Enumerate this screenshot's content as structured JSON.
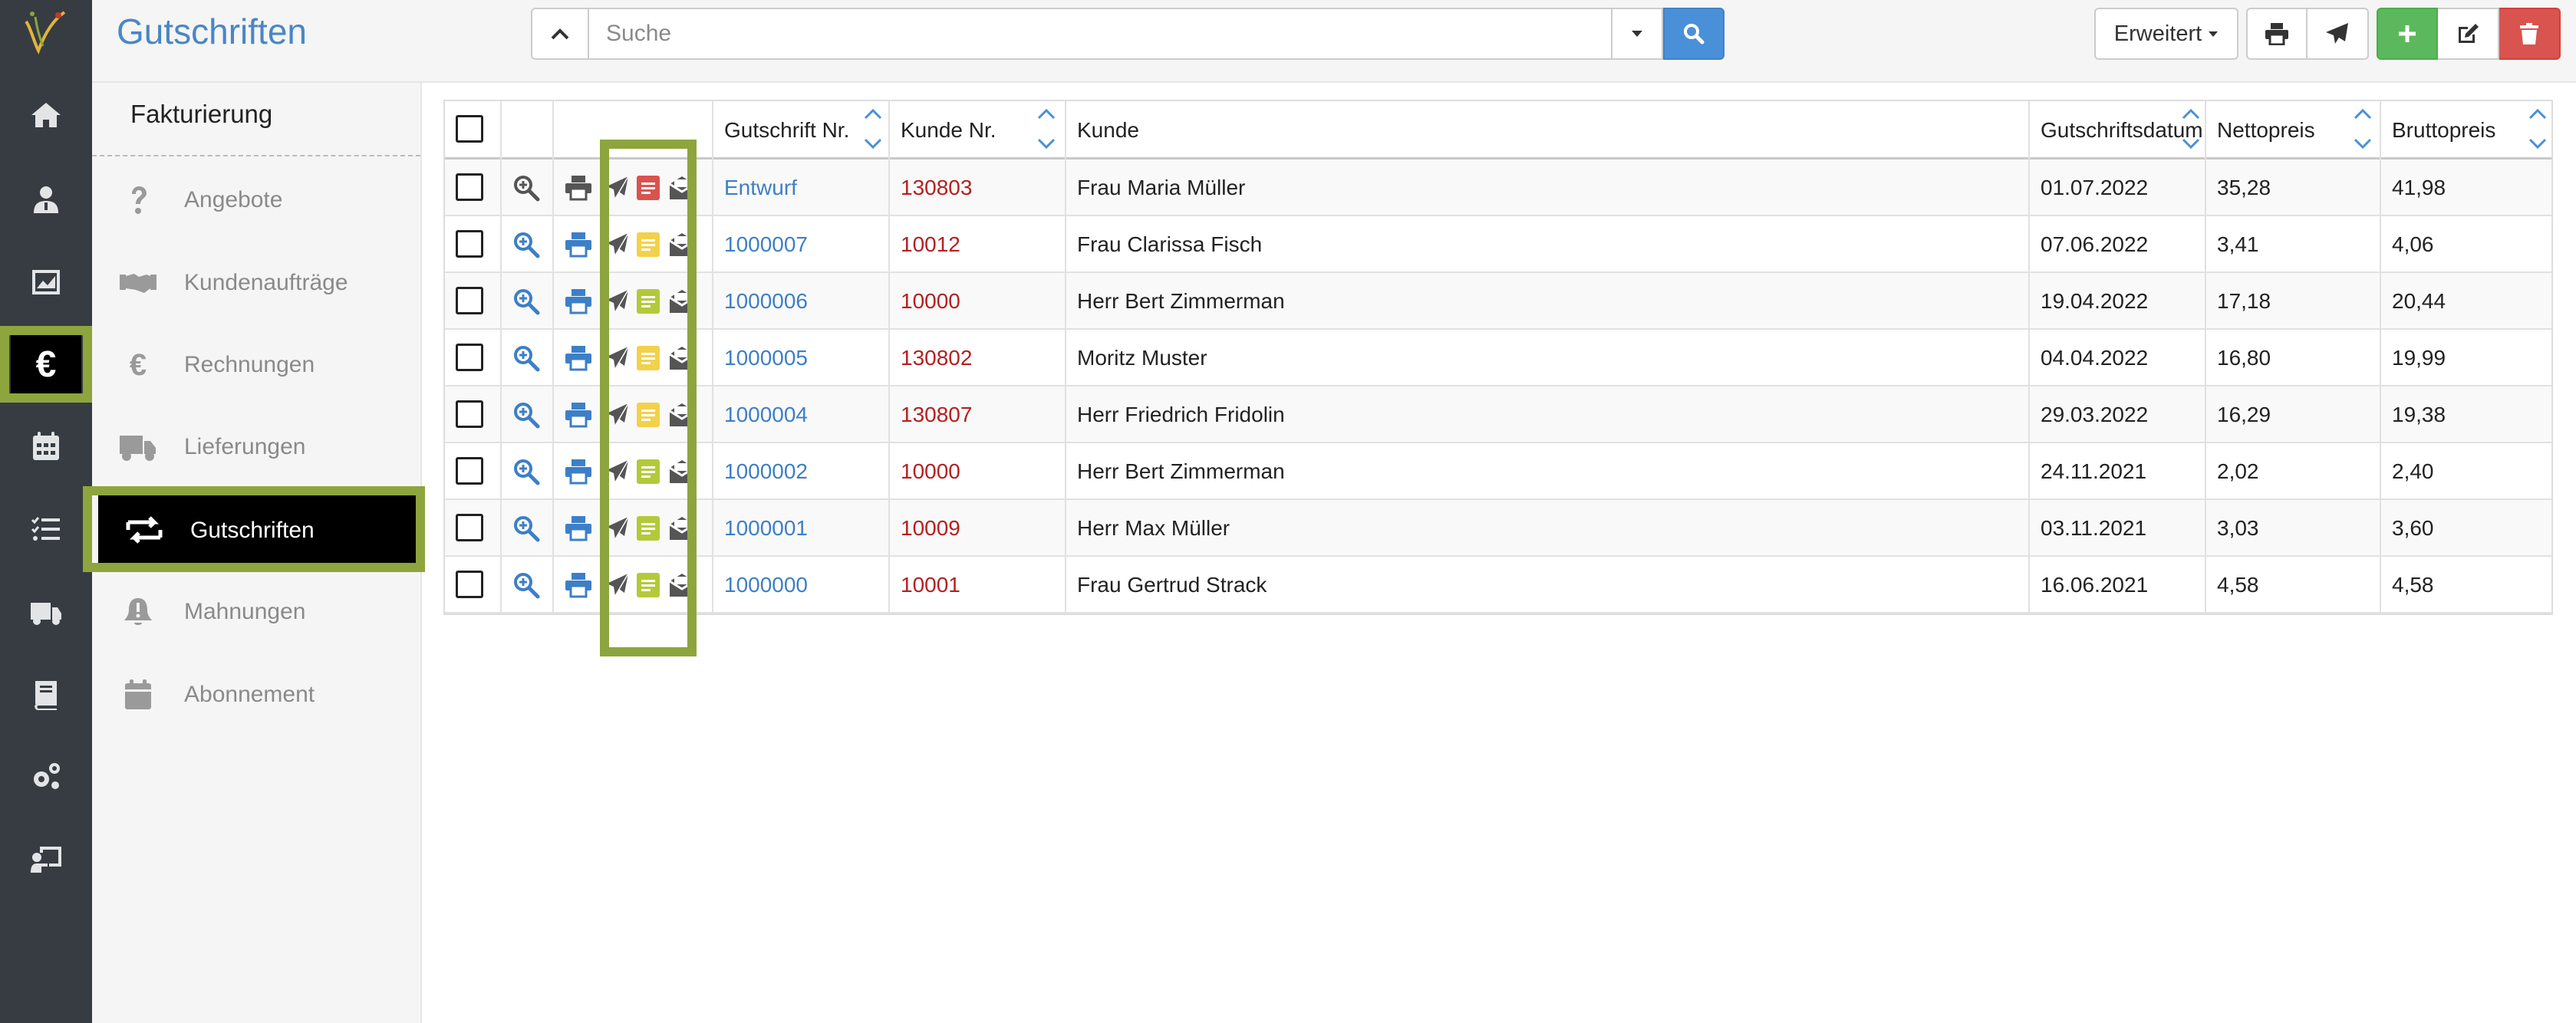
{
  "header": {
    "page_title": "Gutschriften",
    "search_placeholder": "Suche",
    "advanced_label": "Erweitert"
  },
  "subnav": {
    "section_title": "Fakturierung",
    "items": [
      {
        "label": "Angebote",
        "icon": "question-icon"
      },
      {
        "label": "Kundenaufträge",
        "icon": "handshake-icon"
      },
      {
        "label": "Rechnungen",
        "icon": "euro-icon"
      },
      {
        "label": "Lieferungen",
        "icon": "truck-icon"
      },
      {
        "label": "Gutschriften",
        "icon": "exchange-icon"
      },
      {
        "label": "Mahnungen",
        "icon": "bell-icon"
      },
      {
        "label": "Abonnement",
        "icon": "calendar-icon"
      }
    ]
  },
  "table": {
    "columns": {
      "number": "Gutschrift Nr.",
      "customer_no": "Kunde Nr.",
      "customer": "Kunde",
      "date": "Gutschriftsdatum",
      "net": "Nettopreis",
      "gross": "Bruttopreis"
    },
    "rows": [
      {
        "number": "Entwurf",
        "customer_no": "130803",
        "customer": "Frau Maria Müller",
        "date": "01.07.2022",
        "net": "35,28",
        "gross": "41,98",
        "doc_status": "red"
      },
      {
        "number": "1000007",
        "customer_no": "10012",
        "customer": "Frau Clarissa Fisch",
        "date": "07.06.2022",
        "net": "3,41",
        "gross": "4,06",
        "doc_status": "yellow"
      },
      {
        "number": "1000006",
        "customer_no": "10000",
        "customer": "Herr Bert Zimmerman",
        "date": "19.04.2022",
        "net": "17,18",
        "gross": "20,44",
        "doc_status": "green"
      },
      {
        "number": "1000005",
        "customer_no": "130802",
        "customer": "Moritz Muster",
        "date": "04.04.2022",
        "net": "16,80",
        "gross": "19,99",
        "doc_status": "yellow"
      },
      {
        "number": "1000004",
        "customer_no": "130807",
        "customer": "Herr Friedrich Fridolin",
        "date": "29.03.2022",
        "net": "16,29",
        "gross": "19,38",
        "doc_status": "yellow"
      },
      {
        "number": "1000002",
        "customer_no": "10000",
        "customer": "Herr Bert Zimmerman",
        "date": "24.11.2021",
        "net": "2,02",
        "gross": "2,40",
        "doc_status": "green"
      },
      {
        "number": "1000001",
        "customer_no": "10009",
        "customer": "Herr Max Müller",
        "date": "03.11.2021",
        "net": "3,03",
        "gross": "3,60",
        "doc_status": "green"
      },
      {
        "number": "1000000",
        "customer_no": "10001",
        "customer": "Frau Gertrud Strack",
        "date": "16.06.2021",
        "net": "4,58",
        "gross": "4,58",
        "doc_status": "green"
      }
    ]
  },
  "colors": {
    "accent": "#4a86c5",
    "highlight": "#8ea53d",
    "rail": "#363c42",
    "link": "#3d7fc7",
    "customer_no": "#b52020",
    "doc_red": "#d9534f",
    "doc_yellow": "#f2d14b",
    "doc_green": "#b4c93a"
  }
}
